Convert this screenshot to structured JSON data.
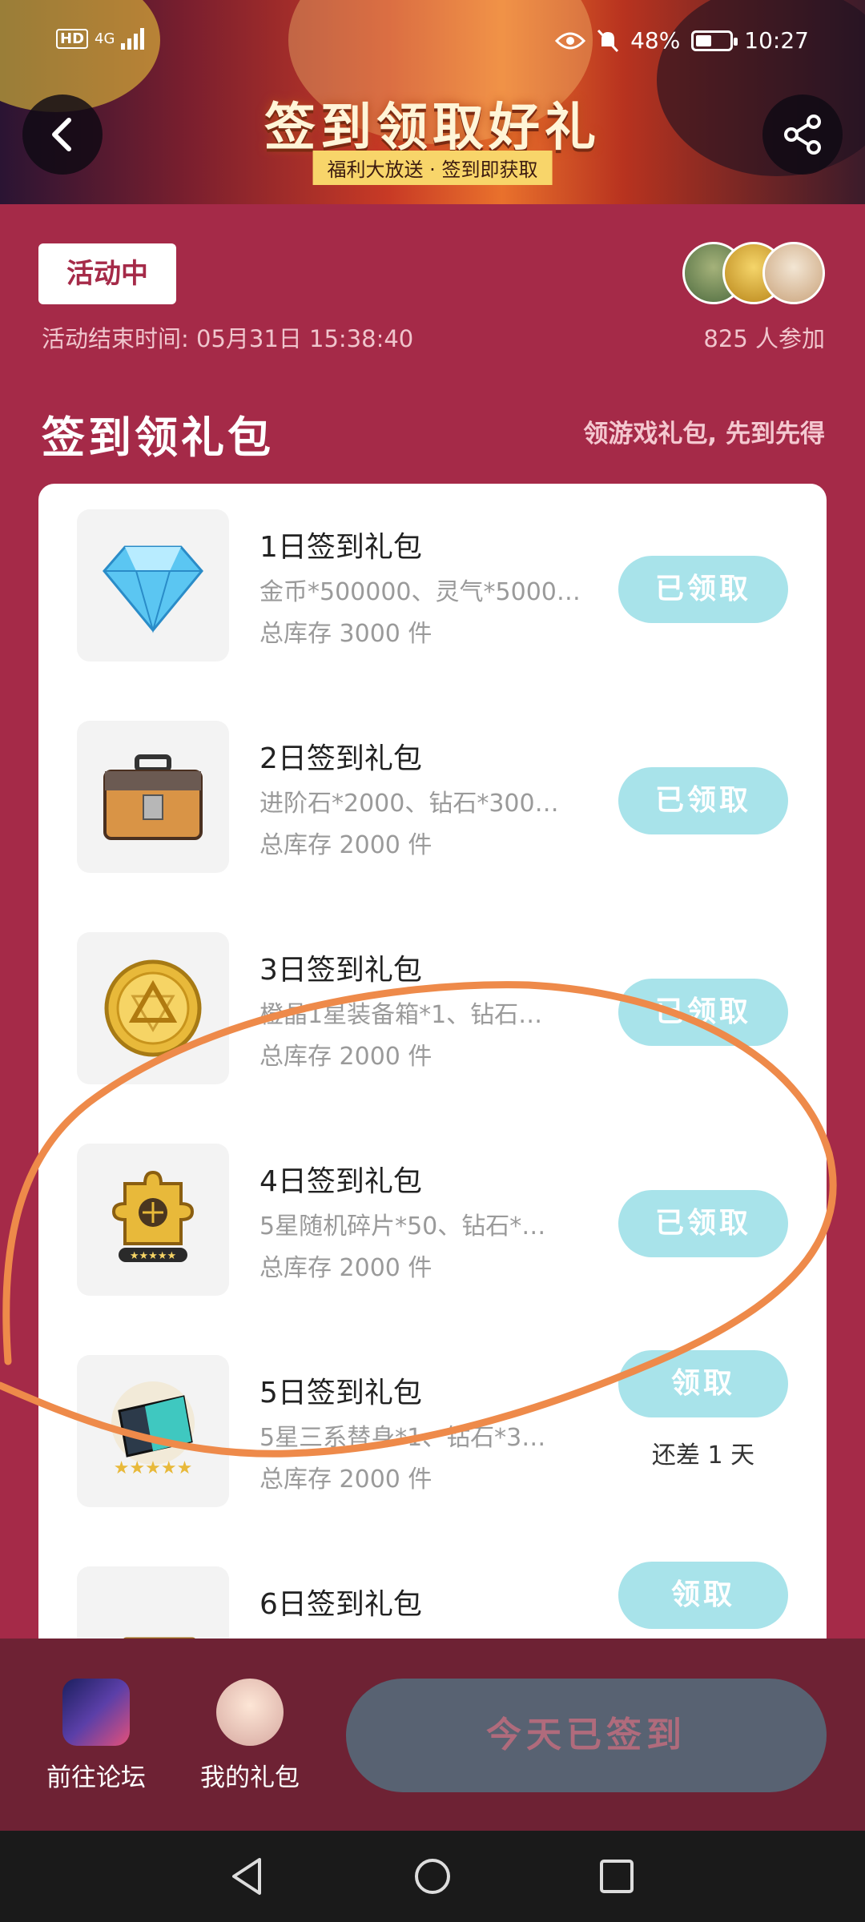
{
  "status_bar": {
    "network": "4G",
    "hd": "HD",
    "battery": "48%",
    "time": "10:27"
  },
  "banner": {
    "title": "签到领取好礼",
    "subtitle": "福利大放送 · 签到即获取"
  },
  "activity": {
    "badge": "活动中",
    "end_time": "活动结束时间: 05月31日  15:38:40",
    "participants": "825 人参加"
  },
  "section": {
    "title": "签到领礼包",
    "subtitle": "领游戏礼包, 先到先得"
  },
  "gifts": [
    {
      "title": "1日签到礼包",
      "desc": "金币*500000、灵气*5000…",
      "stock": "总库存 3000 件",
      "button": "已领取",
      "icon": "diamond-icon"
    },
    {
      "title": "2日签到礼包",
      "desc": "进阶石*2000、钻石*300…",
      "stock": "总库存 2000 件",
      "button": "已领取",
      "icon": "chest-icon"
    },
    {
      "title": "3日签到礼包",
      "desc": "橙晶1星装备箱*1、钻石…",
      "stock": "总库存 2000 件",
      "button": "已领取",
      "icon": "gold-coin-icon"
    },
    {
      "title": "4日签到礼包",
      "desc": "5星随机碎片*50、钻石*…",
      "stock": "总库存 2000 件",
      "button": "已领取",
      "icon": "puzzle-fragment-icon"
    },
    {
      "title": "5日签到礼包",
      "desc": "5星三系替身*1、钻石*3…",
      "stock": "总库存 2000 件",
      "button": "领取",
      "note": "还差 1 天",
      "icon": "card-icon"
    },
    {
      "title": "6日签到礼包",
      "desc": "",
      "stock": "",
      "button": "领取",
      "icon": "ticket-icon"
    }
  ],
  "bottom_bar": {
    "forum": "前往论坛",
    "my_gifts": "我的礼包",
    "signed": "今天已签到"
  },
  "colors": {
    "background": "#a52a48",
    "button_cyan": "#a8e3ea",
    "annotation": "#ee8a4a",
    "bottom_bar": "#6e2234"
  }
}
